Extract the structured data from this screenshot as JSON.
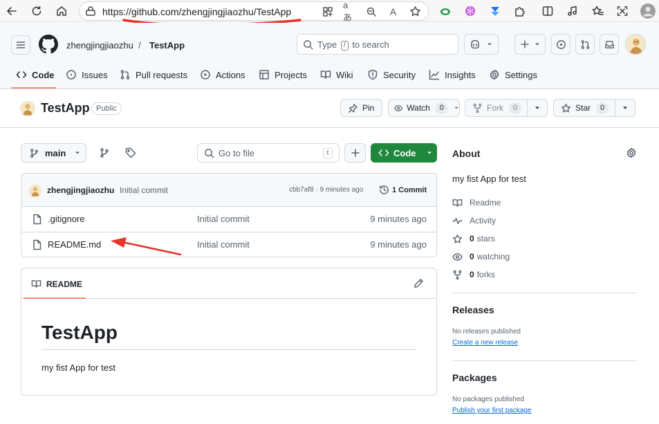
{
  "browser": {
    "url": "https://github.com/zhengjingjiaozhu/TestApp",
    "read_aloud_glyph": "A",
    "translate_glyph": "aあ"
  },
  "header": {
    "owner": "zhengjingjiaozhu",
    "separator": "/",
    "repo": "TestApp",
    "search_prefix": "Type",
    "search_key": "/",
    "search_suffix": "to search"
  },
  "tabs": [
    {
      "label": "Code"
    },
    {
      "label": "Issues"
    },
    {
      "label": "Pull requests"
    },
    {
      "label": "Actions"
    },
    {
      "label": "Projects"
    },
    {
      "label": "Wiki"
    },
    {
      "label": "Security"
    },
    {
      "label": "Insights"
    },
    {
      "label": "Settings"
    }
  ],
  "repo_title": {
    "name": "TestApp",
    "visibility": "Public",
    "pin_label": "Pin",
    "watch_label": "Watch",
    "watch_count": "0",
    "fork_label": "Fork",
    "fork_count": "0",
    "star_label": "Star",
    "star_count": "0"
  },
  "toolbar": {
    "branch": "main",
    "goto_placeholder": "Go to file",
    "goto_key": "t",
    "code_label": "Code"
  },
  "commit": {
    "author": "zhengjingjiaozhu",
    "message": "Initial commit",
    "meta": "cbb7af8 · 9 minutes ago",
    "count_label": "1 Commit"
  },
  "files": [
    {
      "name": ".gitignore",
      "commit": "Initial commit",
      "time": "9 minutes ago"
    },
    {
      "name": "README.md",
      "commit": "Initial commit",
      "time": "9 minutes ago"
    }
  ],
  "readme": {
    "tab_label": "README",
    "heading": "TestApp",
    "body": "my fist App for test"
  },
  "sidebar": {
    "about_title": "About",
    "description": "my fist App for test",
    "readme_link": "Readme",
    "activity_link": "Activity",
    "stars_count": "0",
    "stars_label": "stars",
    "watching_count": "0",
    "watching_label": "watching",
    "forks_count": "0",
    "forks_label": "forks",
    "releases_title": "Releases",
    "releases_empty": "No releases published",
    "create_release": "Create a new release",
    "packages_title": "Packages",
    "packages_empty": "No packages published",
    "publish_package": "Publish your first package"
  },
  "colors": {
    "primary_button": "#1f883d",
    "tab_accent": "#fd8c73",
    "link": "#0969da",
    "annotation": "#e8322c"
  }
}
